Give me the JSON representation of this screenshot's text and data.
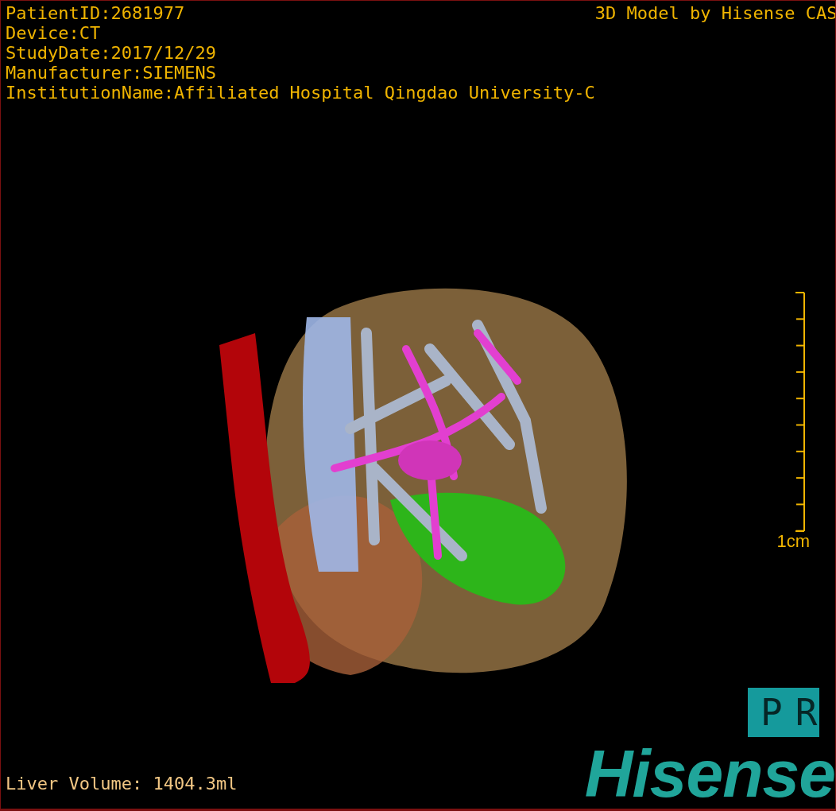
{
  "patient_info": [
    "PatientID:2681977",
    "Device:CT",
    "StudyDate:2017/12/29",
    "Manufacturer:SIEMENS",
    "InstitutionName:Affiliated Hospital Qingdao University-C"
  ],
  "model_credit": "3D Model by Hisense CAS",
  "scale_bar": {
    "label": "1cm"
  },
  "mode_button": {
    "label": "PR"
  },
  "liver_volume": "Liver Volume: 1404.3ml",
  "brand": "Hisense"
}
